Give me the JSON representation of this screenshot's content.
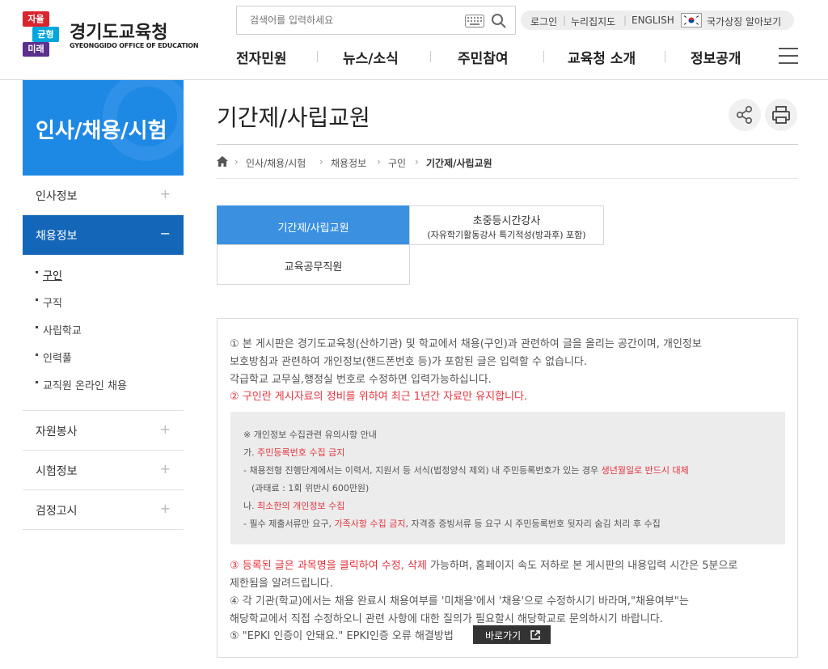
{
  "header": {
    "logo": {
      "mark": [
        "자율",
        "균형",
        "미래"
      ],
      "name_kr": "경기도교육청",
      "name_en": "GYEONGGIDO OFFICE OF EDUCATION"
    },
    "search": {
      "placeholder": "검색어를 입력하세요"
    },
    "util_links": [
      "로그인",
      "누리집지도",
      "ENGLISH",
      "국가상징 알아보기"
    ],
    "gnb": [
      "전자민원",
      "뉴스/소식",
      "주민참여",
      "교육청 소개",
      "정보공개"
    ]
  },
  "sidebar": {
    "title": "인사/채용/시험",
    "menu": [
      {
        "label": "인사정보",
        "sign": "+"
      },
      {
        "label": "채용정보",
        "sign": "−"
      }
    ],
    "sub": [
      "구인",
      "구직",
      "사립학교",
      "인력풀",
      "교직원 온라인 채용"
    ],
    "menu2": [
      {
        "label": "자원봉사",
        "sign": "+"
      },
      {
        "label": "시험정보",
        "sign": "+"
      },
      {
        "label": "검정고시",
        "sign": "+"
      }
    ]
  },
  "main": {
    "title": "기간제/사립교원",
    "breadcrumb": [
      "인사/채용/시험",
      "채용정보",
      "구인",
      "기간제/사립교원"
    ],
    "tabs": [
      {
        "label": "기간제/사립교원"
      },
      {
        "label": "초중등시간강사",
        "sub": "(자유학기활동강사 특기적성(방과후) 포함)"
      },
      {
        "label": "교육공무직원"
      }
    ],
    "notice": {
      "p1": "① 본 게시판은 경기도교육청(산하기관) 및 학교에서 채용(구인)과 관련하여 글을 올리는 공간이며, 개인정보",
      "p1b": "보호방침과 관련하여 개인정보(핸드폰번호 등)가 포함된 글은 입력할 수 없습니다.",
      "p1c": "각급학교 교무실,행정실 번호로 수정하면 입력가능하십니다.",
      "p2": "② 구인란 게시자료의 정비를 위하여 최근 1년간 자료만 유지합니다.",
      "box": {
        "title": "※ 개인정보 수집관련 유의사항 안내",
        "a_prefix": "가. ",
        "a_red": "주민등록번호 수집 금지",
        "a1_pre": "- 채용전형 진행단계에서는 이력서, 지원서 등 서식(법정양식 제외) 내 주민등록번호가 있는 경우 ",
        "a1_red": "생년월일로 반드시 대체",
        "a2": "(과태료 : 1회 위반시 600만원)",
        "b_prefix": "나. ",
        "b_red": "최소한의 개인정보 수집",
        "b1_pre": "- 필수 제출서류만 요구, ",
        "b1_red": "가족사항 수집 금지",
        "b1_post": ", 자격증 증빙서류 등 요구 시 주민등록번호 뒷자리 숨김 처리 후 수집"
      },
      "p3_red": "③ 등록된 글은 과목명을 클릭하여 수정, 삭제",
      "p3_post": " 가능하며, 홈페이지 속도 저하로 본 게시판의 내용입력 시간은 5분으로",
      "p3b": "제한됨을 알려드립니다.",
      "p4": "④ 각 기관(학교)에서는 채용 완료시 채용여부를 '미채용'에서 '채용'으로 수정하시기 바라며,\"채용여부\"는",
      "p4b": "해당학교에서 직접 수정하오니 관련 사항에 대한 질의가 필요할시 해당학교로 문의하시기 바랍니다.",
      "p5": "⑤ \"EPKI 인증이 안돼요.\" EPKI인증 오류 해결방법",
      "goto": "바로가기"
    }
  }
}
